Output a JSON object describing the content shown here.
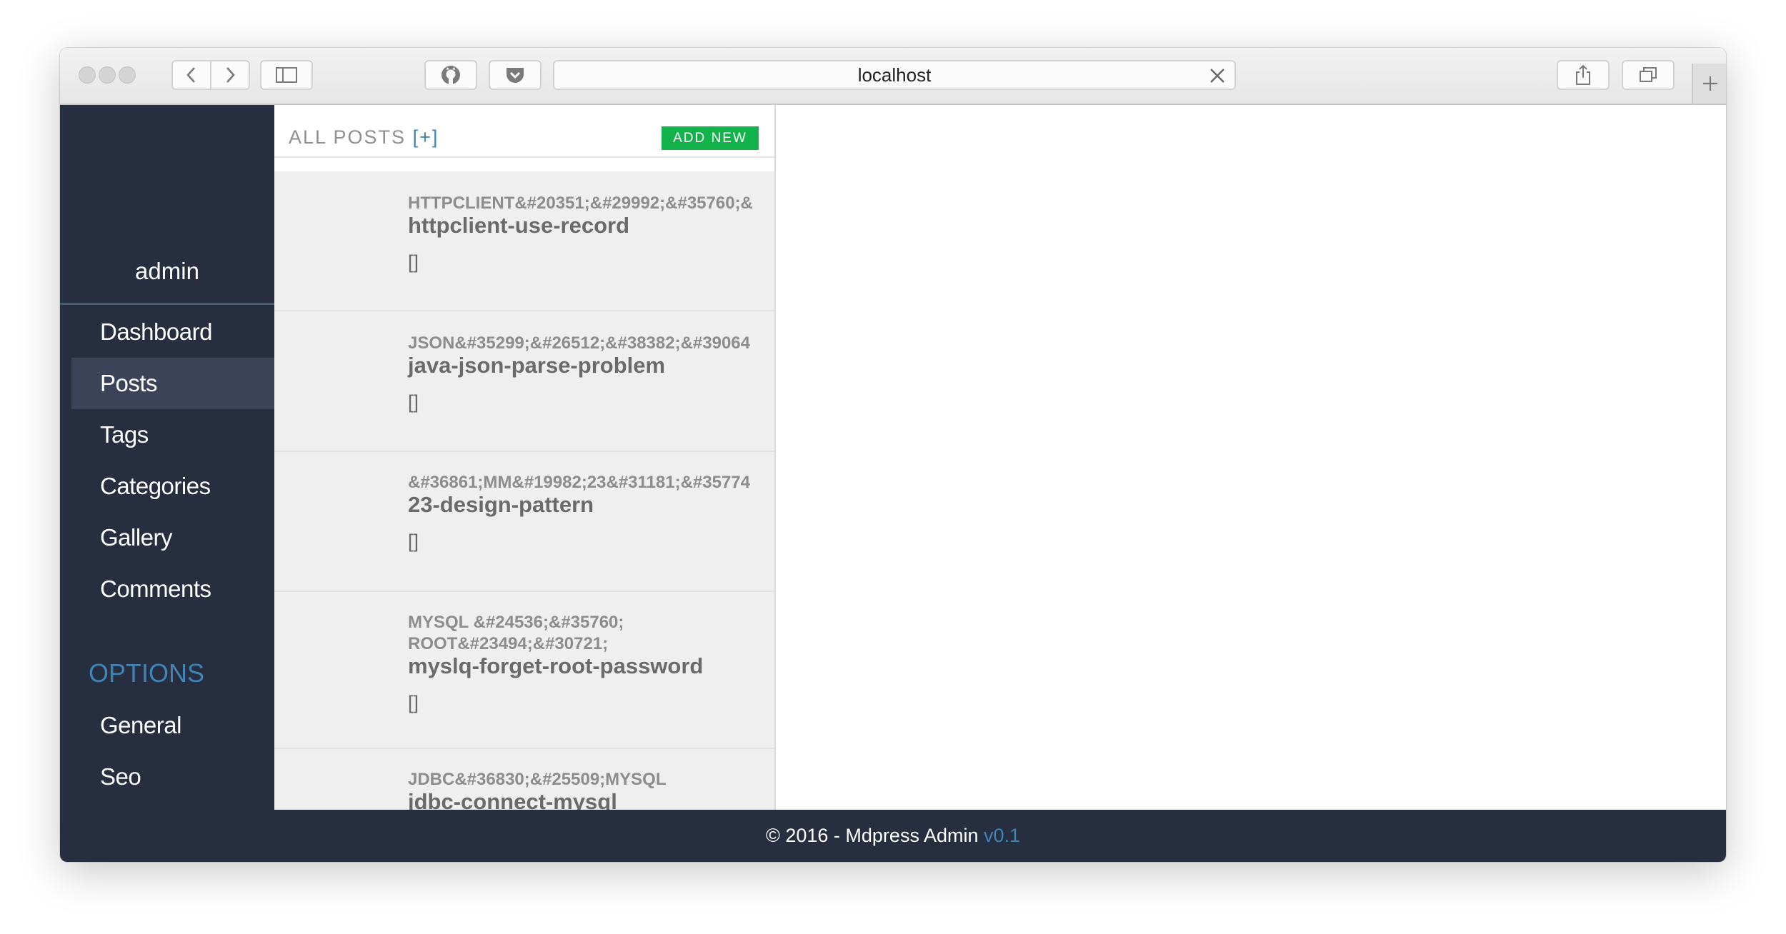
{
  "browser": {
    "url": "localhost",
    "icons": {
      "back": "chevron-left-icon",
      "forward": "chevron-right-icon",
      "sidebar": "sidebar-icon",
      "github": "github-icon",
      "pocket": "pocket-icon",
      "clear": "close-icon",
      "share": "share-icon",
      "tabs": "tabs-icon",
      "new_tab": "plus-icon"
    }
  },
  "sidebar": {
    "username": "admin",
    "nav": [
      {
        "label": "Dashboard",
        "active": false
      },
      {
        "label": "Posts",
        "active": true
      },
      {
        "label": "Tags",
        "active": false
      },
      {
        "label": "Categories",
        "active": false
      },
      {
        "label": "Gallery",
        "active": false
      },
      {
        "label": "Comments",
        "active": false
      }
    ],
    "options_heading": "OPTIONS",
    "options": [
      {
        "label": "General"
      },
      {
        "label": "Seo"
      }
    ]
  },
  "list": {
    "title": "ALL POSTS",
    "title_plus": "[+]",
    "add_new": "ADD NEW",
    "posts": [
      {
        "category": "HTTPCLIENT&#20351;&#29992;&#35760;&",
        "title": "httpclient-use-record",
        "tags": "[]"
      },
      {
        "category": "JSON&#35299;&#26512;&#38382;&#39064",
        "title": "java-json-parse-problem",
        "tags": "[]"
      },
      {
        "category": "&#36861;MM&#19982;23&#31181;&#35774",
        "title": "23-design-pattern",
        "tags": "[]"
      },
      {
        "category": "MYSQL &#24536;&#35760; ROOT&#23494;&#30721;",
        "title": "myslq-forget-root-password",
        "tags": "[]"
      },
      {
        "category": "JDBC&#36830;&#25509;MYSQL",
        "title": "jdbc-connect-mysql",
        "tags": "[]"
      }
    ]
  },
  "footer": {
    "text": "© 2016 - Mdpress Admin",
    "version": "v0.1"
  },
  "colors": {
    "sidebar_bg": "#262e3f",
    "active_item": "#3b4359",
    "accent": "#3f84b4",
    "add_new_bg": "#12b34b",
    "post_bg": "#efefef"
  }
}
